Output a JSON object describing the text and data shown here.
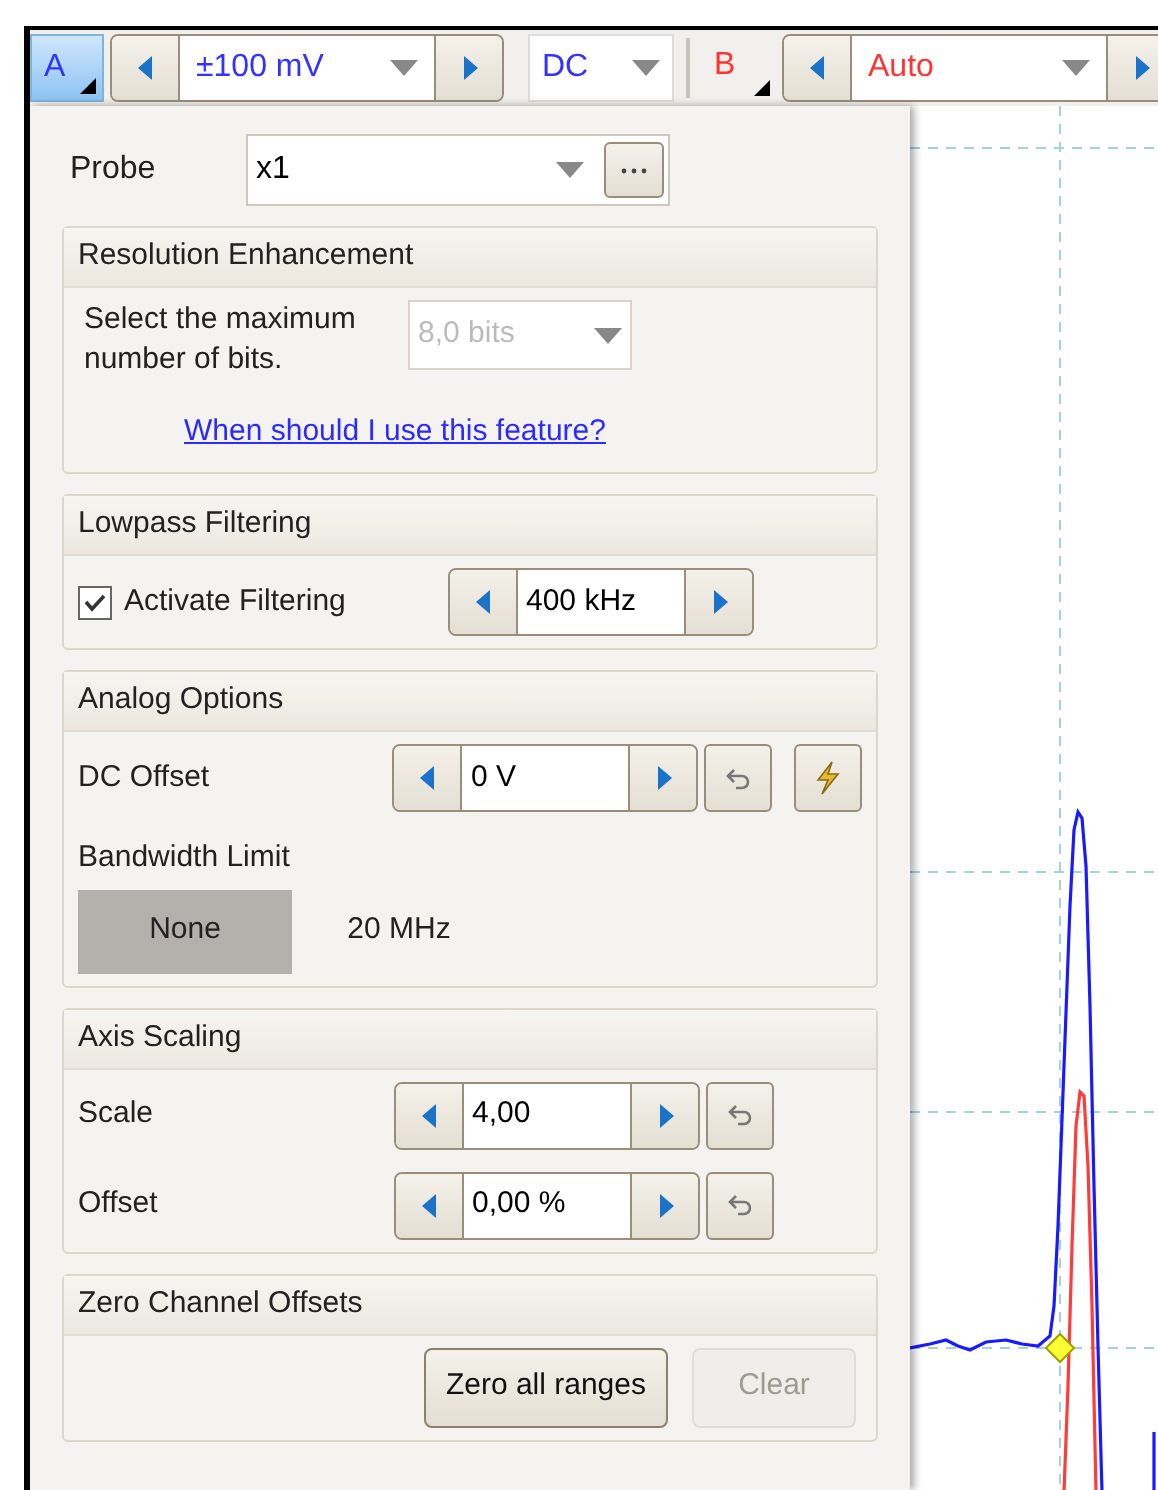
{
  "toolbar": {
    "channels": [
      {
        "label": "A",
        "color": "#3333ff",
        "selected": true,
        "range": "±100 mV",
        "coupling": "DC"
      },
      {
        "label": "B",
        "color": "#ff3333",
        "selected": false,
        "range": "Auto"
      }
    ]
  },
  "probe": {
    "label": "Probe",
    "value": "x1"
  },
  "resolution": {
    "title": "Resolution Enhancement",
    "prompt": "Select the maximum number of bits.",
    "bits": "8,0 bits",
    "bits_disabled": true,
    "link": "When should I use this feature?"
  },
  "lowpass": {
    "title": "Lowpass Filtering",
    "label": "Activate Filtering",
    "checked": true,
    "value": "400 kHz"
  },
  "analog": {
    "title": "Analog Options",
    "dc_offset": {
      "label": "DC Offset",
      "value": "0 V"
    },
    "bandwidth": {
      "label": "Bandwidth Limit",
      "options": [
        {
          "label": "None",
          "selected": true
        },
        {
          "label": "20 MHz",
          "selected": false
        }
      ]
    }
  },
  "axis": {
    "title": "Axis Scaling",
    "rows": [
      {
        "label": "Scale",
        "value": "4,00"
      },
      {
        "label": "Offset",
        "value": "0,00 %"
      }
    ]
  },
  "zero": {
    "title": "Zero Channel Offsets",
    "buttons": [
      {
        "label": "Zero all ranges",
        "disabled": false
      },
      {
        "label": "Clear",
        "disabled": true
      }
    ]
  }
}
